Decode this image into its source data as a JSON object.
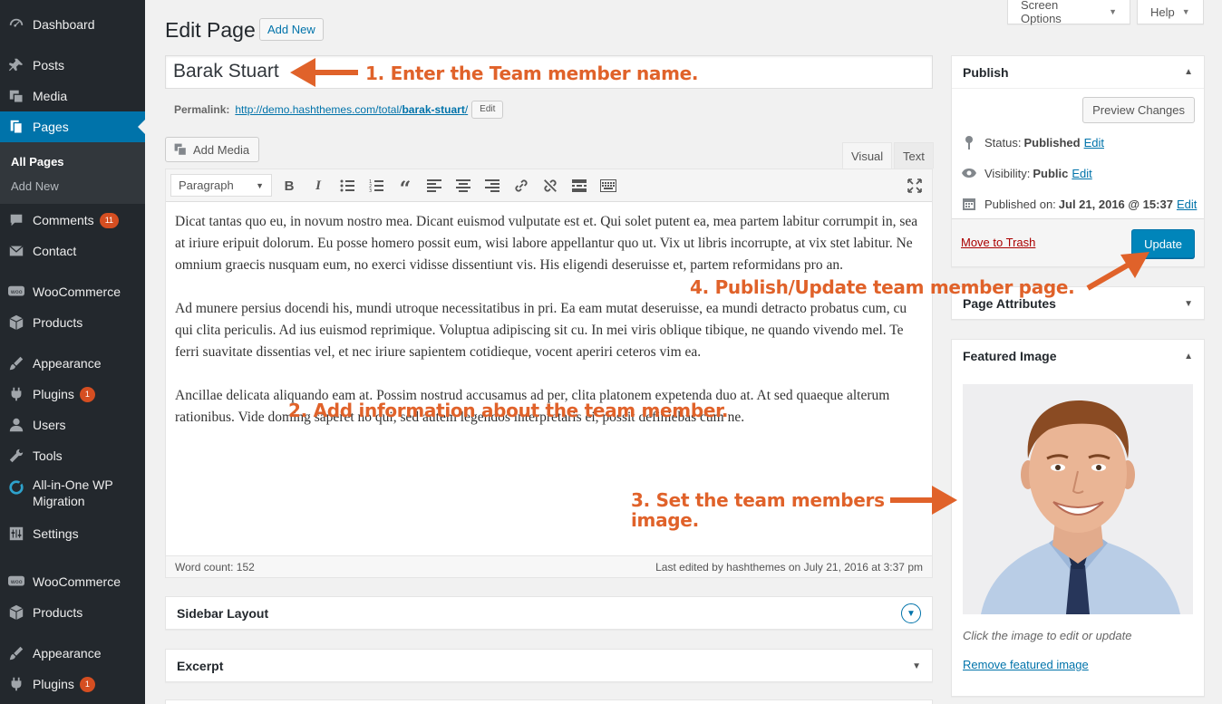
{
  "sidebar": {
    "dashboard": "Dashboard",
    "posts": "Posts",
    "media": "Media",
    "pages": "Pages",
    "all_pages": "All Pages",
    "add_new": "Add New",
    "comments": "Comments",
    "comments_badge": "11",
    "contact": "Contact",
    "woocommerce": "WooCommerce",
    "products": "Products",
    "appearance": "Appearance",
    "plugins": "Plugins",
    "plugins_badge": "1",
    "users": "Users",
    "tools": "Tools",
    "migration_line1": "All-in-One WP",
    "migration_line2": "Migration",
    "settings": "Settings",
    "woocommerce2": "WooCommerce",
    "products2": "Products",
    "appearance2": "Appearance",
    "plugins2": "Plugins",
    "plugins2_badge": "1"
  },
  "header": {
    "title": "Edit Page",
    "add_new": "Add New",
    "screen_options": "Screen Options",
    "help": "Help"
  },
  "post": {
    "title": "Barak Stuart",
    "permalink_label": "Permalink:",
    "permalink_base": "http://demo.hashthemes.com/total/",
    "permalink_slug": "barak-stuart",
    "permalink_end": "/",
    "permalink_edit": "Edit"
  },
  "editor": {
    "add_media": "Add Media",
    "tab_visual": "Visual",
    "tab_text": "Text",
    "format": "Paragraph",
    "paragraphs": [
      "Dicat tantas quo eu, in novum nostro mea. Dicant euismod vulputate est et. Qui solet putent ea, mea partem labitur corrumpit in, sea at iriure eripuit dolorum. Eu posse homero possit eum, wisi labore appellantur quo ut. Vix ut libris incorrupte, at vix stet labitur. Ne omnium graecis nusquam eum, no exerci vidisse dissentiunt vis. His eligendi deseruisse et, partem reformidans pro an.",
      "Ad munere persius docendi his, mundi utroque necessitatibus in pri. Ea eam mutat deseruisse, ea mundi detracto probatus cum, cu qui clita periculis. Ad ius euismod reprimique. Voluptua adipiscing sit cu. In mei viris oblique tibique, ne quando vivendo mel. Te ferri suavitate dissentias vel, et nec iriure sapientem cotidieque, vocent aperiri ceteros vim ea.",
      "Ancillae delicata aliquando eam at. Possim nostrud accusamus ad per, clita platonem expetenda duo at. At sed quaeque alterum rationibus. Vide doming saperet no qui, sed autem legendos interpretaris ei, possit definiebas cum ne."
    ],
    "word_count": "Word count: 152",
    "last_edited": "Last edited by hashthemes on July 21, 2016 at 3:37 pm"
  },
  "metaboxes": {
    "sidebar_layout": "Sidebar Layout",
    "excerpt": "Excerpt"
  },
  "publish": {
    "title": "Publish",
    "preview": "Preview Changes",
    "status_label": "Status:",
    "status_value": "Published",
    "visibility_label": "Visibility:",
    "visibility_value": "Public",
    "published_label": "Published on:",
    "published_value": "Jul 21, 2016 @ 15:37",
    "edit": "Edit",
    "trash": "Move to Trash",
    "update": "Update"
  },
  "page_attributes": {
    "title": "Page Attributes"
  },
  "featured": {
    "title": "Featured Image",
    "caption": "Click the image to edit or update",
    "remove": "Remove featured image"
  },
  "annotations": {
    "step1": "1. Enter the Team member name.",
    "step2": "2. Add information about the team member.",
    "step3_line1": "3. Set the team members",
    "step3_line2": "image.",
    "step4": "4. Publish/Update team member page."
  },
  "colors": {
    "sidebar_bg": "#23282d",
    "active": "#0073aa",
    "annotation": "#e0622a",
    "badge": "#d54e21"
  }
}
